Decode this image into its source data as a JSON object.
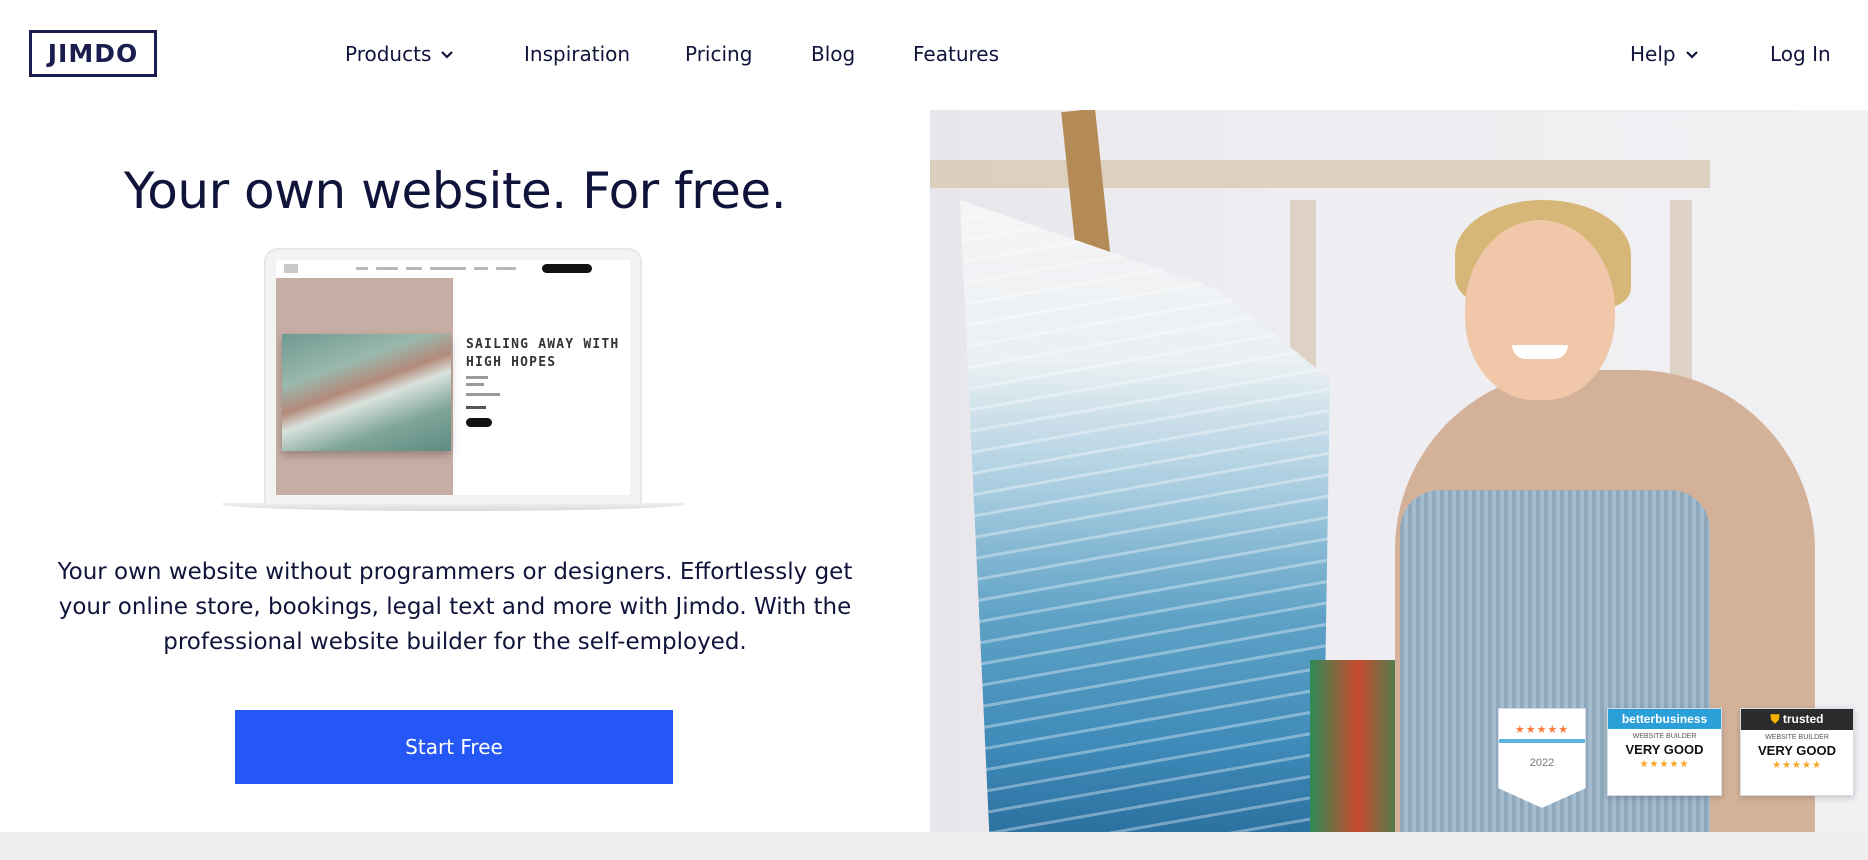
{
  "brand": {
    "logo_text": "JIMDO"
  },
  "nav": {
    "items": [
      {
        "label": "Products",
        "has_dropdown": true
      },
      {
        "label": "Inspiration",
        "has_dropdown": false
      },
      {
        "label": "Pricing",
        "has_dropdown": false
      },
      {
        "label": "Blog",
        "has_dropdown": false
      },
      {
        "label": "Features",
        "has_dropdown": false
      }
    ],
    "help": "Help",
    "login": "Log In"
  },
  "hero": {
    "title": "Your own website. For free.",
    "description": "Your own website without programmers or designers. Effortlessly get your online store, bookings, legal text and more with Jimdo. With the professional website builder for the self-employed.",
    "cta": "Start Free",
    "mockup_heading": "SAILING AWAY WITH HIGH HOPES"
  },
  "badges": {
    "g2": {
      "year": "2022"
    },
    "betterbusiness": {
      "brand": "betterbusiness",
      "category": "Website Builder",
      "rating": "VERY GOOD"
    },
    "trusted": {
      "brand": "trusted",
      "category": "Website Builder",
      "rating": "VERY GOOD"
    }
  },
  "colors": {
    "accent": "#2457f5",
    "text": "#11143a"
  }
}
